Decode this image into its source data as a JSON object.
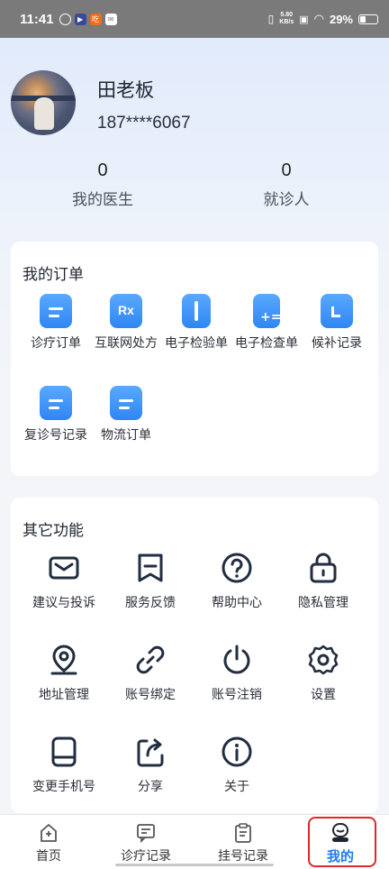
{
  "status_bar": {
    "time": "11:41",
    "network_speed_top": "5.80",
    "network_speed_unit": "KB/s",
    "battery": "29%"
  },
  "profile": {
    "name": "田老板",
    "phone": "187****6067"
  },
  "stats": [
    {
      "value": "0",
      "label": "我的医生"
    },
    {
      "value": "0",
      "label": "就诊人"
    }
  ],
  "orders": {
    "title": "我的订单",
    "items": [
      {
        "label": "诊疗订单",
        "icon": "clipboard-icon"
      },
      {
        "label": "互联网处方",
        "icon": "rx-prescription-icon"
      },
      {
        "label": "电子检验单",
        "icon": "notebook-icon"
      },
      {
        "label": "电子检查单",
        "icon": "medicine-bottle-icon"
      },
      {
        "label": "候补记录",
        "icon": "calendar-icon"
      },
      {
        "label": "复诊号记录",
        "icon": "clipboard-icon"
      },
      {
        "label": "物流订单",
        "icon": "clipboard-icon"
      }
    ]
  },
  "functions": {
    "title": "其它功能",
    "items": [
      {
        "label": "建议与投诉",
        "icon": "mail-icon"
      },
      {
        "label": "服务反馈",
        "icon": "feedback-icon"
      },
      {
        "label": "帮助中心",
        "icon": "help-icon"
      },
      {
        "label": "隐私管理",
        "icon": "lock-icon"
      },
      {
        "label": "地址管理",
        "icon": "location-icon"
      },
      {
        "label": "账号绑定",
        "icon": "link-icon"
      },
      {
        "label": "账号注销",
        "icon": "power-icon"
      },
      {
        "label": "设置",
        "icon": "gear-icon"
      },
      {
        "label": "变更手机号",
        "icon": "phone-icon"
      },
      {
        "label": "分享",
        "icon": "share-icon"
      },
      {
        "label": "关于",
        "icon": "info-icon"
      }
    ]
  },
  "tabbar": {
    "items": [
      {
        "label": "首页",
        "icon": "home-icon"
      },
      {
        "label": "诊疗记录",
        "icon": "chat-icon"
      },
      {
        "label": "挂号记录",
        "icon": "clipboard-icon"
      },
      {
        "label": "我的",
        "icon": "user-icon"
      }
    ],
    "active_index": 3
  },
  "colors": {
    "accent": "#1d7cf2",
    "icon_blue": "#3b8ff5",
    "highlight": "#e02828"
  }
}
